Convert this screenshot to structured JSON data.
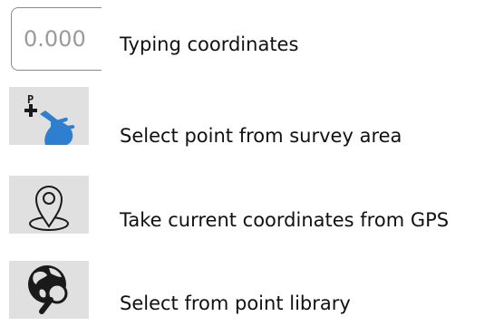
{
  "options": [
    {
      "id": "typing",
      "icon": "coordinate-input-icon",
      "icon_text": "0.000",
      "label": "Typing coordinates"
    },
    {
      "id": "survey",
      "icon": "hand-point-plus-icon",
      "icon_text": "P",
      "label": "Select point from survey area"
    },
    {
      "id": "gps",
      "icon": "location-pin-icon",
      "label": "Take current coordinates from GPS"
    },
    {
      "id": "library",
      "icon": "globe-magnifier-icon",
      "label": "Select from point library"
    }
  ],
  "colors": {
    "tile_background": "#e0e0e0",
    "hand_blue": "#2f7fd0",
    "icon_dark": "#1a1a1a"
  }
}
